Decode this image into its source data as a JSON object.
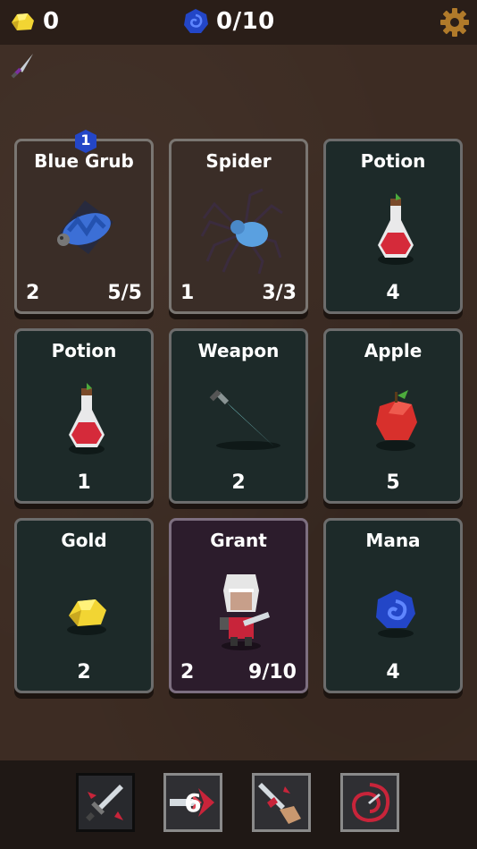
{
  "hud": {
    "gold_count": "0",
    "mana_count": "0/10"
  },
  "cards": [
    {
      "title": "Blue Grub",
      "left": "2",
      "right": "5/5",
      "badge": "1"
    },
    {
      "title": "Spider",
      "left": "1",
      "right": "3/3"
    },
    {
      "title": "Potion",
      "value": "4"
    },
    {
      "title": "Potion",
      "value": "1"
    },
    {
      "title": "Weapon",
      "value": "2"
    },
    {
      "title": "Apple",
      "value": "5"
    },
    {
      "title": "Gold",
      "value": "2"
    },
    {
      "title": "Grant",
      "left": "2",
      "right": "9/10"
    },
    {
      "title": "Mana",
      "value": "4"
    }
  ],
  "abilities": [
    {
      "name": "strike"
    },
    {
      "name": "dash",
      "count": "6"
    },
    {
      "name": "power-strike"
    },
    {
      "name": "whirl"
    }
  ],
  "colors": {
    "gold": "#f2d533",
    "mana": "#2346c7",
    "gear": "#b07a2a",
    "potion": "#d52a3a",
    "apple": "#d8302c"
  }
}
